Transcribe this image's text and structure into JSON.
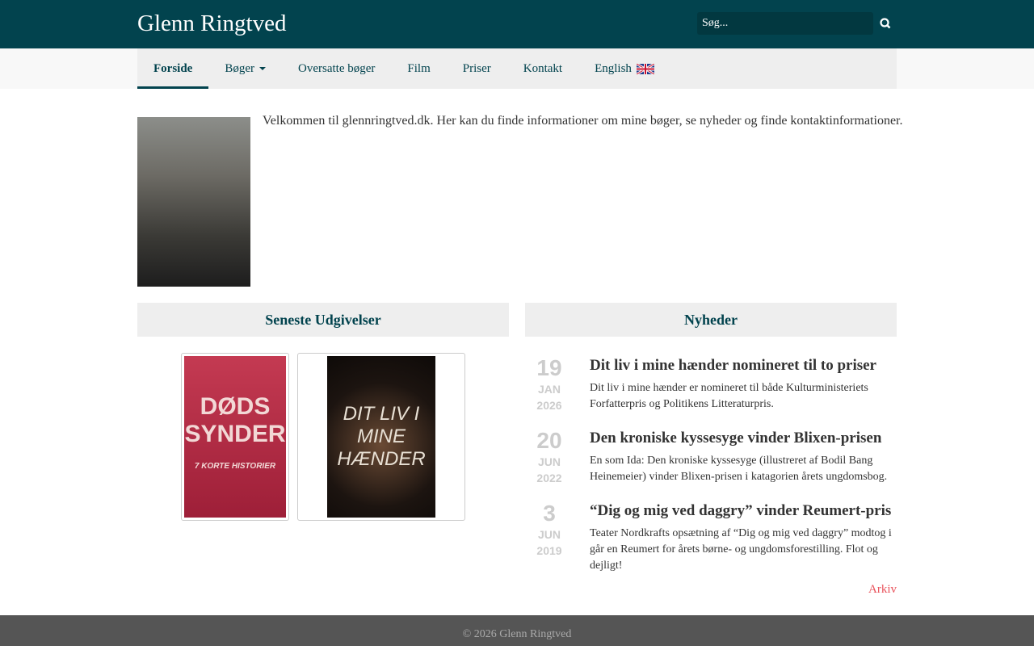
{
  "header": {
    "title": "Glenn Ringtved",
    "search_placeholder": "Søg..."
  },
  "nav": [
    "Forside",
    "Bøger",
    "Oversatte bøger",
    "Film",
    "Priser",
    "Kontakt",
    "English"
  ],
  "welcome": "Velkommen til glennringtved.dk. Her kan du finde informationer om mine bøger, se nyheder og finde kontaktinformationer.",
  "releases": {
    "heading": "Seneste Udgivelser",
    "books": [
      {
        "title": "DØDS SYNDER",
        "subtitle": "7 KORTE HISTORIER"
      },
      {
        "title": "DIT LIV I MINE HÆNDER"
      }
    ]
  },
  "news": {
    "heading": "Nyheder",
    "items": [
      {
        "day": "19",
        "month": "JAN",
        "year": "2026",
        "title": "Dit liv i mine hænder nomineret til to priser",
        "text": "Dit liv i mine hænder er nomineret til både Kulturministeriets Forfatterpris og Politikens Litteraturpris."
      },
      {
        "day": "20",
        "month": "JUN",
        "year": "2022",
        "title": "Den kroniske kyssesyge vinder Blixen-prisen",
        "text": "En som Ida: Den kroniske kyssesyge (illustreret af Bodil Bang Heinemeier) vinder Blixen-prisen i katagorien årets ungdomsbog."
      },
      {
        "day": "3",
        "month": "JUN",
        "year": "2019",
        "title": "“Dig og mig ved daggry” vinder Reumert-pris",
        "text": "Teater Nordkrafts opsætning af “Dig og mig ved daggry” modtog i går en Reumert for årets børne- og ungdomsforestilling. Flot og dejligt!"
      }
    ],
    "archive": "Arkiv"
  },
  "footer": "© 2026 Glenn Ringtved"
}
